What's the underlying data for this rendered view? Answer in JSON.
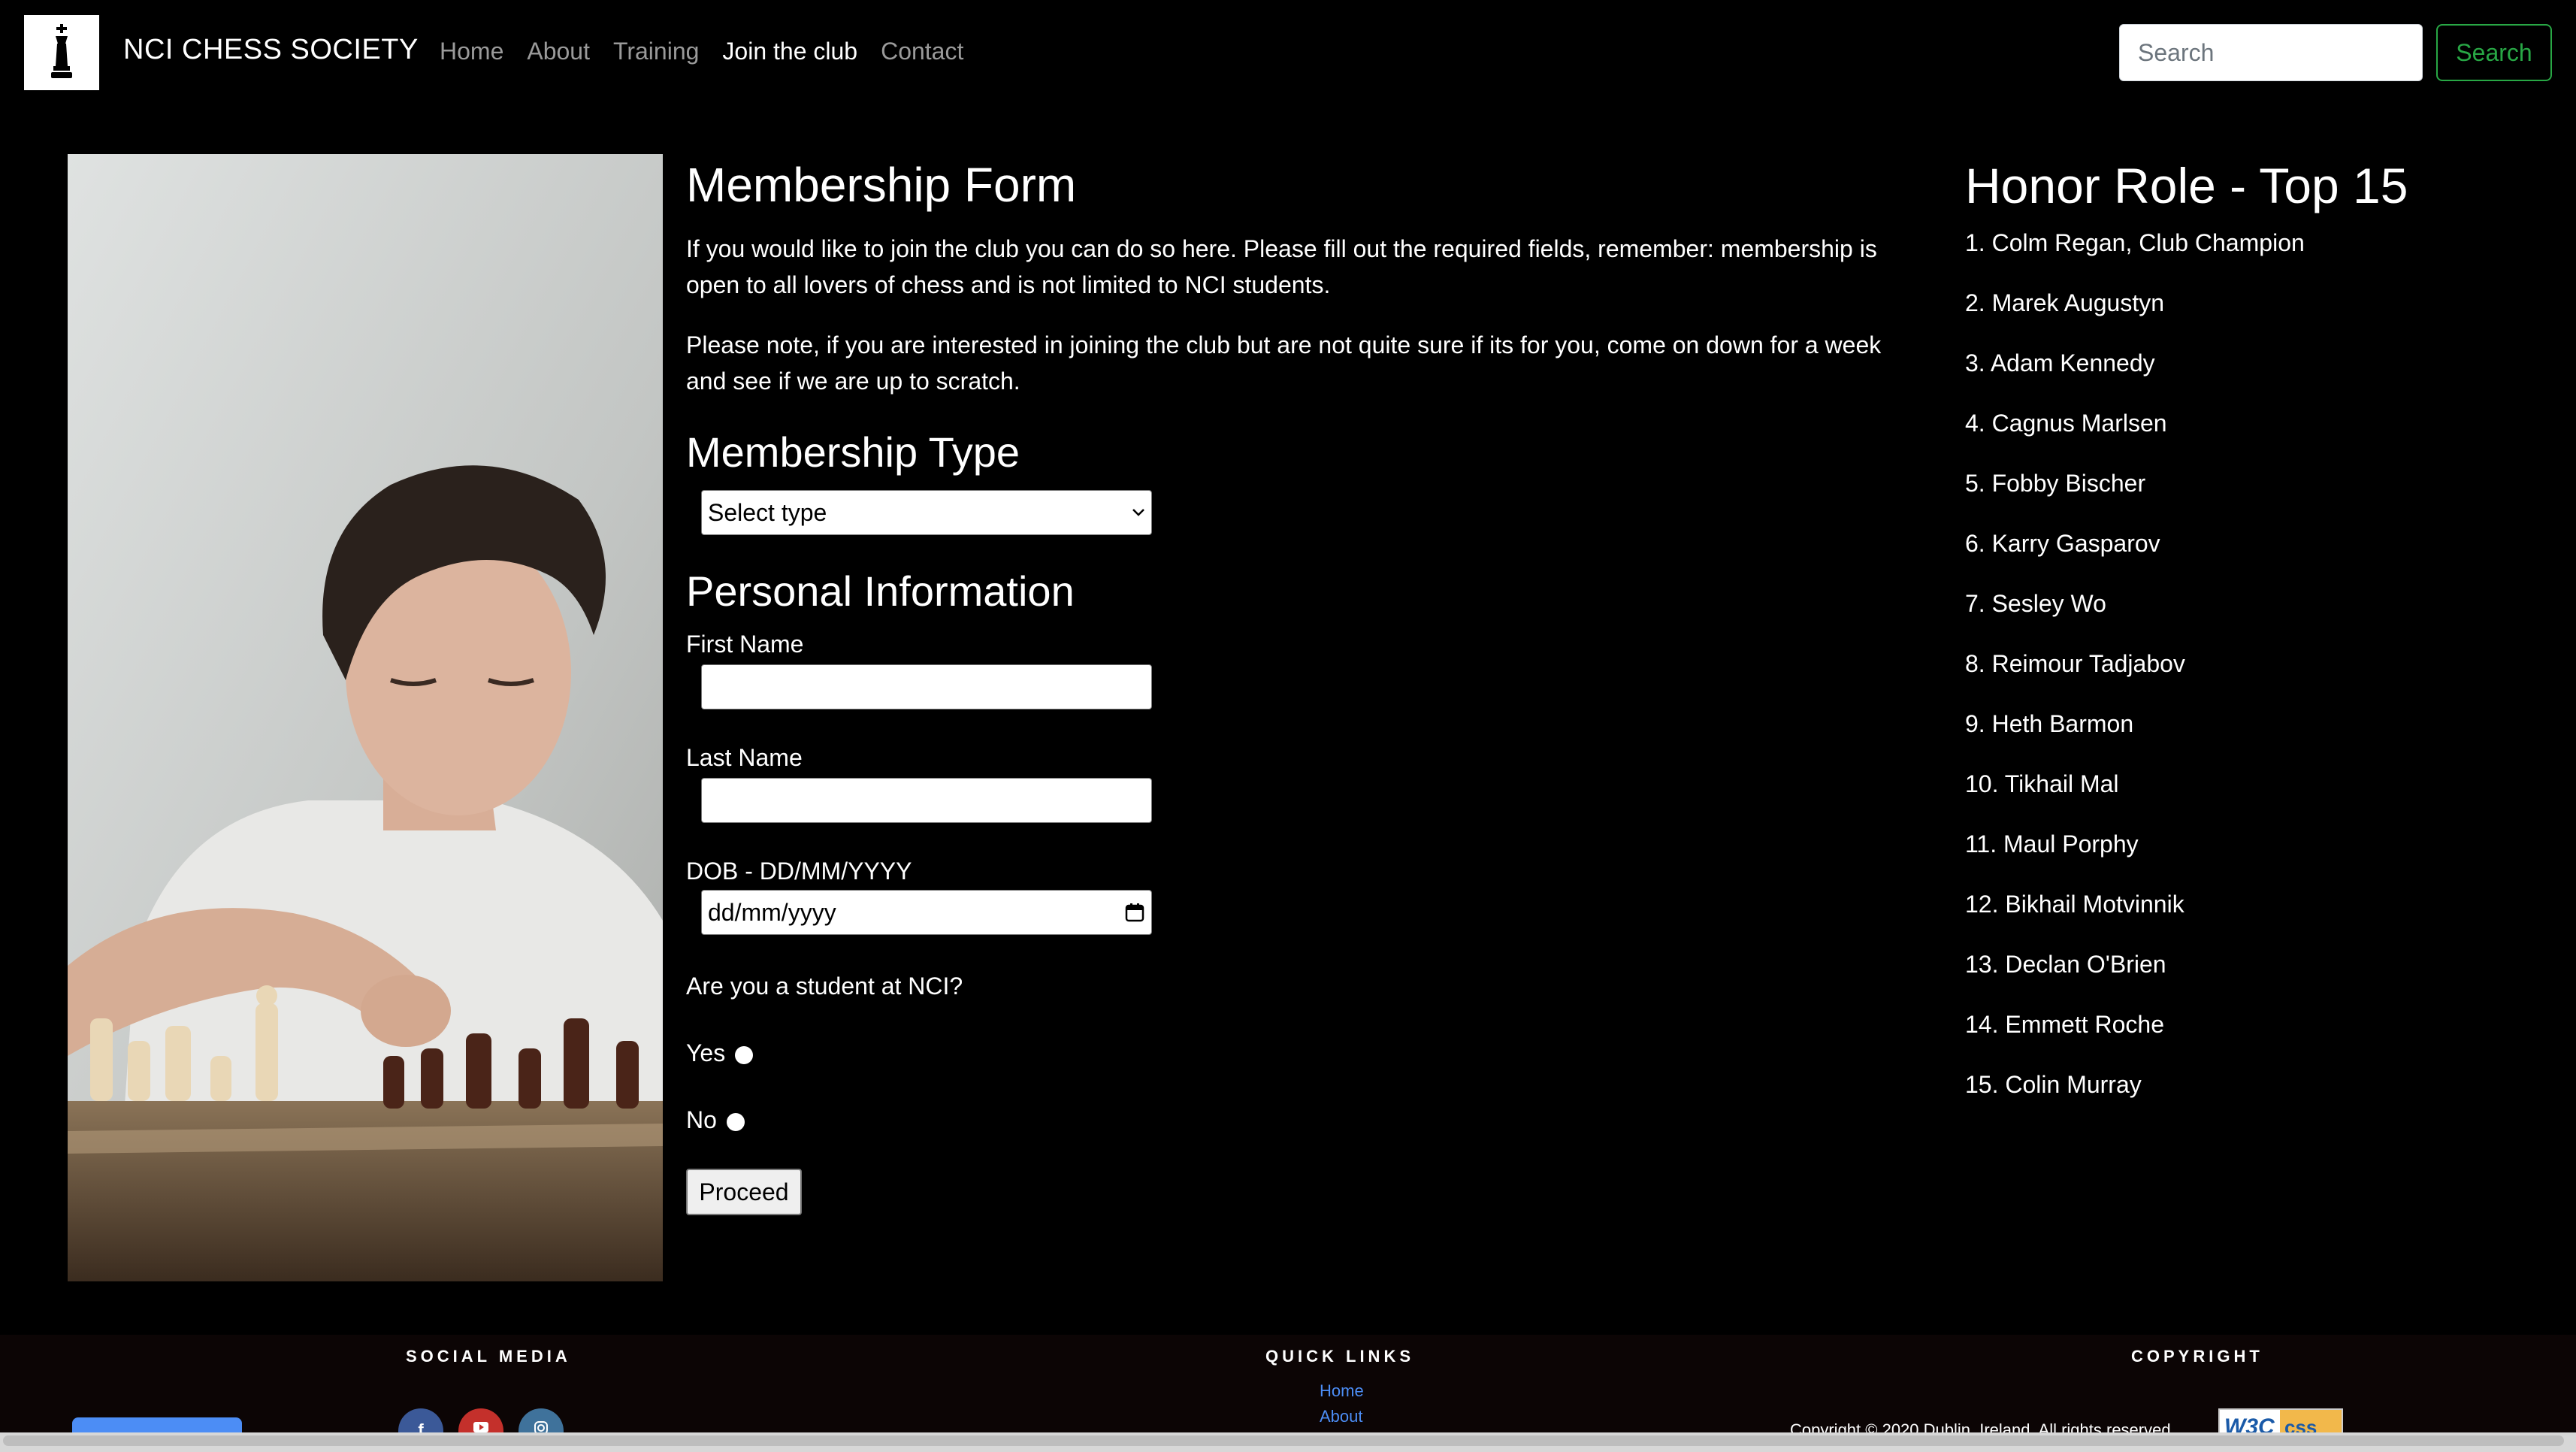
{
  "navbar": {
    "brand": "NCI CHESS SOCIETY",
    "links": [
      {
        "label": "Home"
      },
      {
        "label": "About"
      },
      {
        "label": "Training"
      },
      {
        "label": "Join the club"
      },
      {
        "label": "Contact"
      }
    ],
    "active": "Join the club",
    "search_placeholder": "Search",
    "search_button": "Search"
  },
  "form": {
    "title": "Membership Form",
    "intro": "If you would like to join the club you can do so here. Please fill out the required fields, remember: membership is open to all lovers of chess and is not limited to NCI students.",
    "note": "Please note, if you are interested in joining the club but are not quite sure if its for you, come on down for a week and see if we are up to scratch.",
    "membership_type_heading": "Membership Type",
    "select_value": "Select type",
    "personal_heading": "Personal Information",
    "first_name_label": "First Name",
    "last_name_label": "Last Name",
    "dob_label": "DOB - DD/MM/YYYY",
    "dob_value": "dd/mm/yyyy",
    "student_question": "Are you a student at NCI?",
    "yes_label": "Yes",
    "no_label": "No",
    "proceed": "Proceed"
  },
  "honor": {
    "title": "Honor Role - Top 15",
    "entries": [
      "1. Colm Regan, Club Champion",
      "2. Marek Augustyn",
      "3. Adam Kennedy",
      "4. Cagnus Marlsen",
      "5. Fobby Bischer",
      "6. Karry Gasparov",
      "7. Sesley Wo",
      "8. Reimour Tadjabov",
      "9. Heth Barmon",
      "10. Tikhail Mal",
      "11. Maul Porphy",
      "12. Bikhail Motvinnik",
      "13. Declan O'Brien",
      "14. Emmett Roche",
      "15. Colin Murray"
    ]
  },
  "footer": {
    "social_heading": "SOCIAL MEDIA",
    "quick_links_heading": "QUICK LINKS",
    "copyright_heading": "COPYRIGHT",
    "quick_links": [
      "Home",
      "About"
    ],
    "copyright_text": "Copyright © 2020 Dublin, Ireland. All rights reserved."
  },
  "colors": {
    "background": "#000000",
    "search_accent": "#28a745",
    "footer_link": "#4c8df5",
    "facebook": "#3b5998",
    "youtube": "#c4302b",
    "instagram": "#3f729b"
  },
  "icons": [
    "king-chess-logo-icon",
    "calendar-icon",
    "chevron-down-icon",
    "facebook-icon",
    "youtube-icon",
    "instagram-icon",
    "w3c-css-badge-icon"
  ]
}
